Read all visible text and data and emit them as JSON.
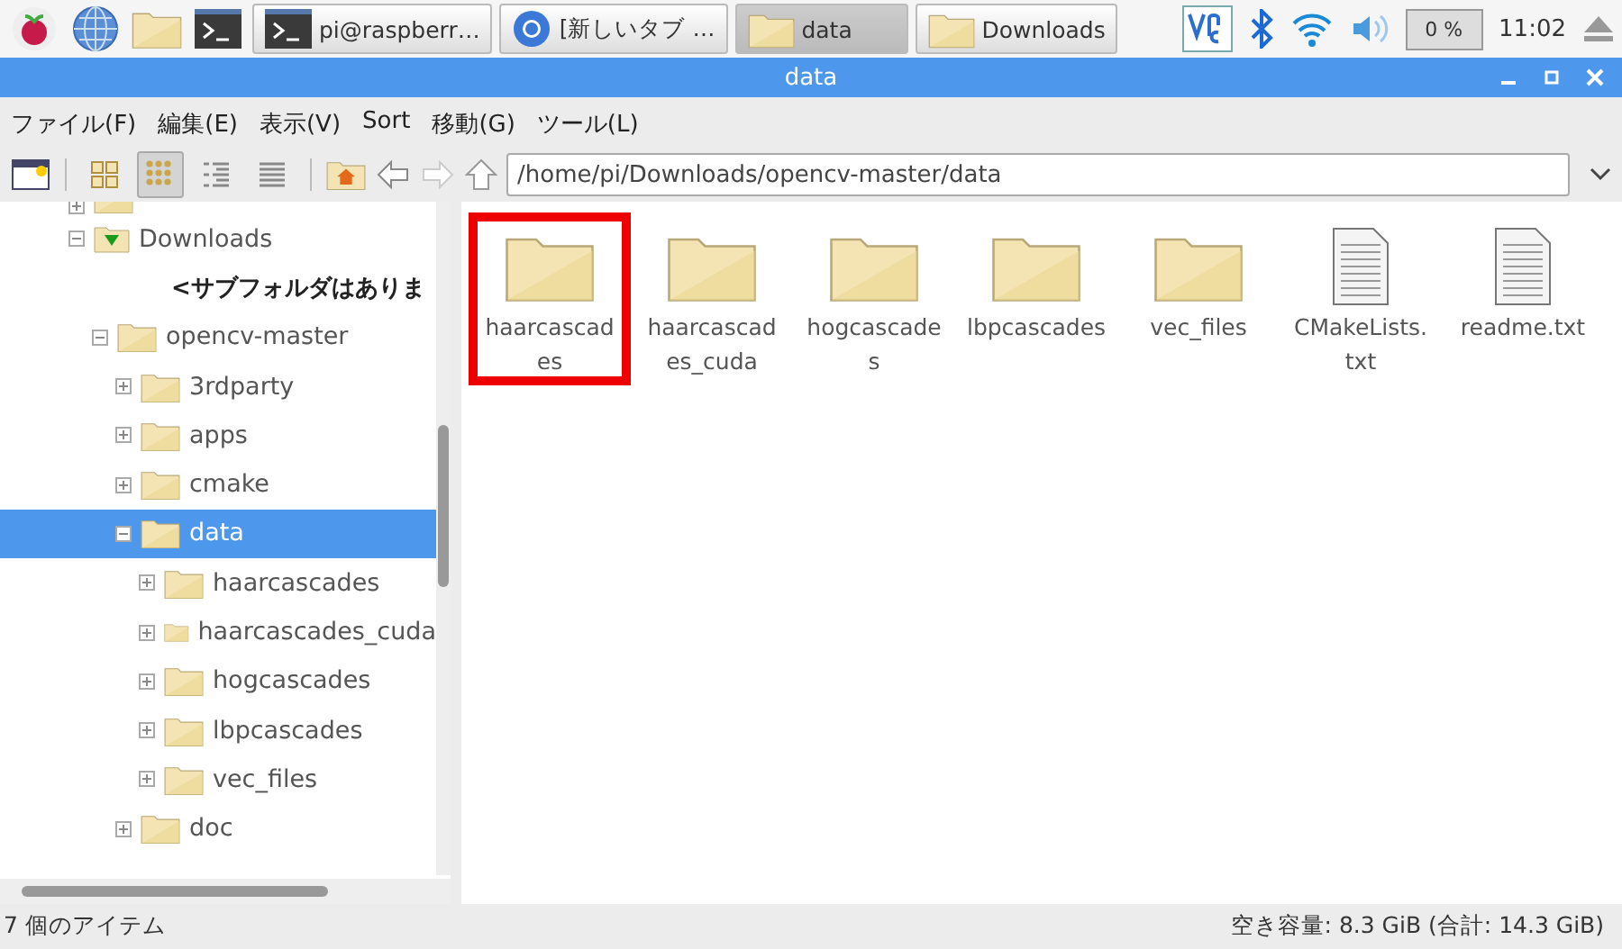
{
  "taskbar": {
    "launchers": [
      {
        "kind": "raspberry"
      },
      {
        "kind": "globe"
      },
      {
        "kind": "folder"
      },
      {
        "kind": "terminal"
      }
    ],
    "tasks": [
      {
        "label": "pi@raspberr…",
        "kind": "terminal",
        "selected": false
      },
      {
        "label": "[新しいタブ …",
        "kind": "browser",
        "selected": false
      },
      {
        "label": "data",
        "kind": "folder",
        "selected": true
      },
      {
        "label": "Downloads",
        "kind": "folder",
        "selected": false
      }
    ],
    "cpu": "0 %",
    "clock": "11:02"
  },
  "window": {
    "title": "data"
  },
  "menu": [
    "ファイル(F)",
    "編集(E)",
    "表示(V)",
    "Sort",
    "移動(G)",
    "ツール(L)"
  ],
  "toolbar": {
    "views": [
      {
        "kind": "thumbnail",
        "selected": false
      },
      {
        "kind": "icon",
        "selected": true
      },
      {
        "kind": "compact",
        "selected": false
      },
      {
        "kind": "list",
        "selected": false
      }
    ],
    "address": "/home/pi/Downloads/opencv-master/data"
  },
  "tree": [
    {
      "label": "Downloads",
      "kind": "downloads",
      "expanded": true,
      "selected": false,
      "children": [
        {
          "label": "<サブフォルダはありま",
          "kind": "note"
        },
        {
          "label": "opencv-master",
          "kind": "folder",
          "expanded": true,
          "selected": false,
          "children": [
            {
              "label": "3rdparty",
              "kind": "folder",
              "expanded": false,
              "selected": false
            },
            {
              "label": "apps",
              "kind": "folder",
              "expanded": false,
              "selected": false
            },
            {
              "label": "cmake",
              "kind": "folder",
              "expanded": false,
              "selected": false
            },
            {
              "label": "data",
              "kind": "folder",
              "expanded": true,
              "selected": true,
              "children": [
                {
                  "label": "haarcascades",
                  "kind": "folder",
                  "expanded": false,
                  "selected": false
                },
                {
                  "label": "haarcascades_cuda",
                  "kind": "folder",
                  "expanded": false,
                  "selected": false
                },
                {
                  "label": "hogcascades",
                  "kind": "folder",
                  "expanded": false,
                  "selected": false
                },
                {
                  "label": "lbpcascades",
                  "kind": "folder",
                  "expanded": false,
                  "selected": false
                },
                {
                  "label": "vec_files",
                  "kind": "folder",
                  "expanded": false,
                  "selected": false
                }
              ]
            },
            {
              "label": "doc",
              "kind": "folder",
              "expanded": false,
              "selected": false
            }
          ]
        }
      ]
    }
  ],
  "files": [
    {
      "name": "haarcascades",
      "kind": "folder",
      "highlighted": true
    },
    {
      "name": "haarcascades_cuda",
      "kind": "folder",
      "highlighted": false
    },
    {
      "name": "hogcascades",
      "kind": "folder",
      "highlighted": false
    },
    {
      "name": "lbpcascades",
      "kind": "folder",
      "highlighted": false
    },
    {
      "name": "vec_files",
      "kind": "folder",
      "highlighted": false
    },
    {
      "name": "CMakeLists.txt",
      "kind": "text",
      "highlighted": false
    },
    {
      "name": "readme.txt",
      "kind": "text",
      "highlighted": false
    }
  ],
  "status_bar": {
    "items": "7 個のアイテム",
    "space": "空き容量: 8.3 GiB (合計: 14.3 GiB)"
  }
}
